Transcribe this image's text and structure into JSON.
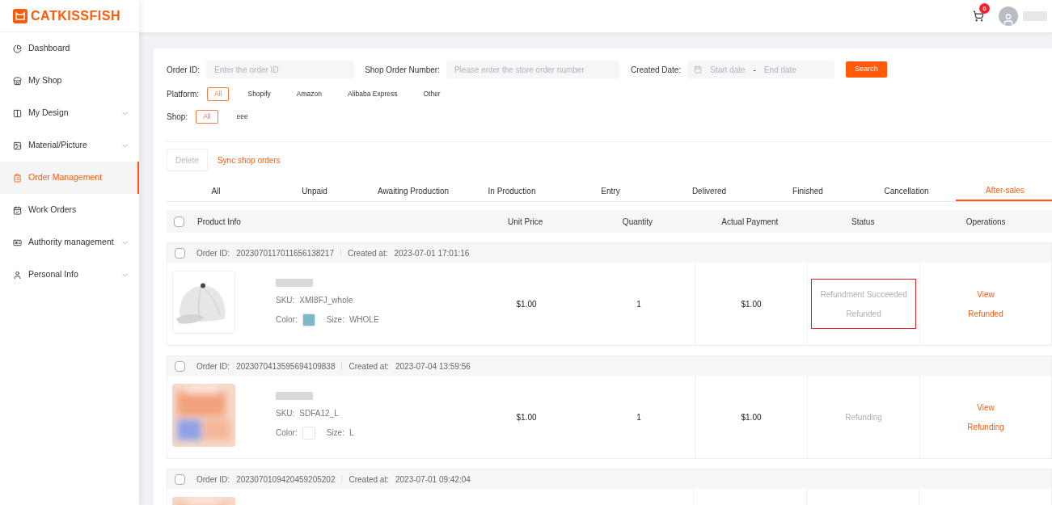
{
  "brand": {
    "name": "CATKISSFISH"
  },
  "sidebar": {
    "items": [
      {
        "label": "Dashboard",
        "selected": false,
        "has_submenu": false
      },
      {
        "label": "My Shop",
        "selected": false,
        "has_submenu": false
      },
      {
        "label": "My Design",
        "selected": false,
        "has_submenu": true
      },
      {
        "label": "Material/Picture",
        "selected": false,
        "has_submenu": true
      },
      {
        "label": "Order Management",
        "selected": true,
        "has_submenu": false
      },
      {
        "label": "Work Orders",
        "selected": false,
        "has_submenu": false
      },
      {
        "label": "Authority management",
        "selected": false,
        "has_submenu": true
      },
      {
        "label": "Personal Info",
        "selected": false,
        "has_submenu": true
      }
    ]
  },
  "header": {
    "cart_badge": "6"
  },
  "filters": {
    "order_id": {
      "label": "Order ID:",
      "placeholder": "Enter the order ID"
    },
    "shop_order_number": {
      "label": "Shop Order Number:",
      "placeholder": "Please enter the store order number"
    },
    "created_date": {
      "label": "Created Date:",
      "start_placeholder": "Start date",
      "separator": "-",
      "end_placeholder": "End date"
    },
    "search_button": "Search",
    "platform": {
      "label": "Platform:",
      "options": [
        {
          "label": "All",
          "selected": true
        },
        {
          "label": "Shopify",
          "selected": false
        },
        {
          "label": "Amazon",
          "selected": false
        },
        {
          "label": "Alibaba Express",
          "selected": false
        },
        {
          "label": "Other",
          "selected": false
        }
      ]
    },
    "shop": {
      "label": "Shop:",
      "options": [
        {
          "label": "All",
          "selected": true
        },
        {
          "label": "eee",
          "selected": false
        }
      ]
    }
  },
  "actions": {
    "delete": {
      "label": "Delete",
      "disabled": true
    },
    "sync": "Sync shop orders"
  },
  "tabs": [
    {
      "label": "All",
      "selected": false
    },
    {
      "label": "Unpaid",
      "selected": false
    },
    {
      "label": "Awaiting Production",
      "selected": false
    },
    {
      "label": "In Production",
      "selected": false
    },
    {
      "label": "Entry",
      "selected": false
    },
    {
      "label": "Delivered",
      "selected": false
    },
    {
      "label": "Finished",
      "selected": false
    },
    {
      "label": "Cancellation",
      "selected": false
    },
    {
      "label": "After-sales",
      "selected": true
    }
  ],
  "table": {
    "all_checked": false,
    "columns": [
      "Product Info",
      "Unit Price",
      "Quantity",
      "Actual Payment",
      "Status",
      "Operations"
    ],
    "orders": [
      {
        "order_id_label": "Order ID:",
        "order_id": "2023070117011656138217",
        "created_label": "Created at:",
        "created_at": "2023-07-01 17:01:16",
        "checked": false,
        "highlighted": true,
        "sku_label": "SKU:",
        "sku": "XMI8FJ_whole",
        "color_label": "Color:",
        "color": "#7fb9c9",
        "size_label": "Size:",
        "size": "WHOLE",
        "unit_price": "$1.00",
        "quantity": "1",
        "actual_payment": "$1.00",
        "status": [
          "Refundment Succeeded",
          "Refunded"
        ],
        "operations": [
          "View",
          "Refunded"
        ]
      },
      {
        "order_id_label": "Order ID:",
        "order_id": "2023070413595694109838",
        "created_label": "Created at:",
        "created_at": "2023-07-04 13:59:56",
        "checked": false,
        "highlighted": false,
        "sku_label": "SKU:",
        "sku": "SDFA12_L",
        "color_label": "Color:",
        "color": "#ffffff",
        "size_label": "Size:",
        "size": "L",
        "unit_price": "$1.00",
        "quantity": "1",
        "actual_payment": "$1.00",
        "status": [
          "Refunding"
        ],
        "operations": [
          "View",
          "Refunding"
        ]
      },
      {
        "order_id_label": "Order ID:",
        "order_id": "2023070109420459205202",
        "created_label": "Created at:",
        "created_at": "2023-07-01 09:42:04",
        "checked": false
      }
    ]
  }
}
